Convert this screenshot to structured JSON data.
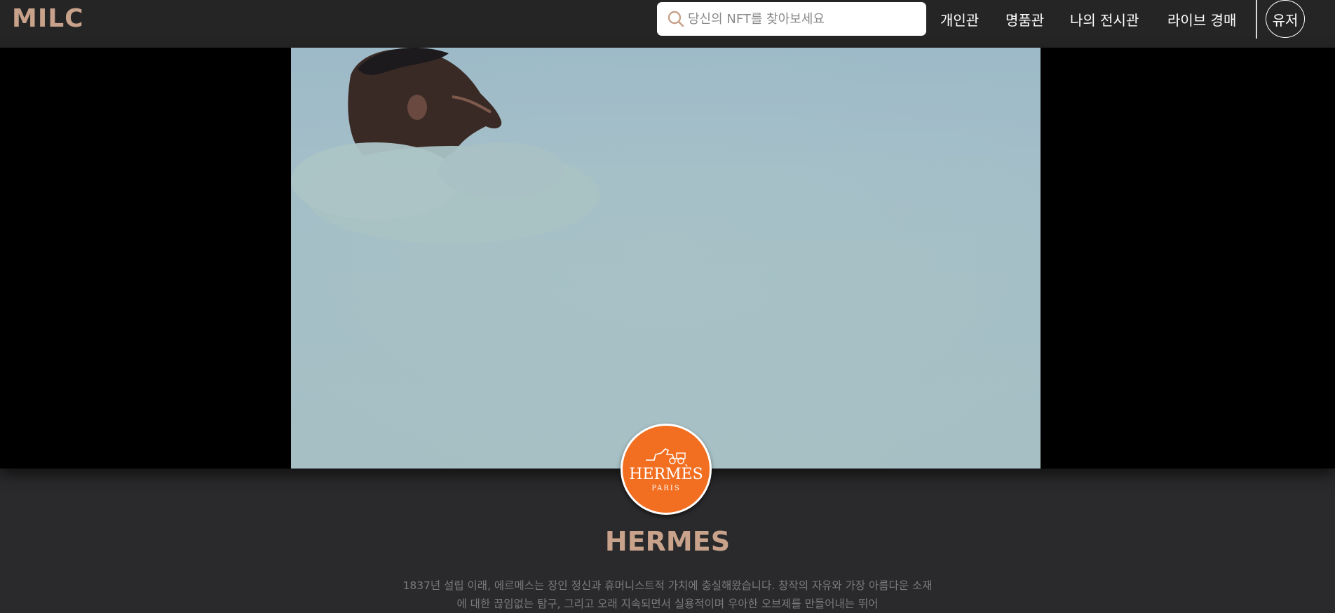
{
  "header": {
    "logo": "MILC",
    "search_placeholder": "당신의 NFT를 찾아보세요",
    "nav": [
      {
        "label": "개인관"
      },
      {
        "label": "명품관"
      },
      {
        "label": "나의 전시관"
      },
      {
        "label": "라이브 경매"
      }
    ],
    "user_label": "유저"
  },
  "hero": {
    "image_icon": "hero-banner-image"
  },
  "brand": {
    "logo_wordmark": "HERMÈS",
    "logo_sub": "PARIS",
    "logo_color": "#f26f22",
    "name": "HERMES",
    "description": "1837년 설립 이래, 에르메스는 장인 정신과 휴머니스트적 가치에 충실해왔습니다. 창작의 자유와 가장 아름다운 소재에 대한 끊임없는 탐구, 그리고 오래 지속되면서 실용적이며 우아한 오브제를 만들어내는 뛰어"
  },
  "colors": {
    "accent": "#c8a28a",
    "topbar": "#252526",
    "page_bg": "#2a2a2c"
  }
}
